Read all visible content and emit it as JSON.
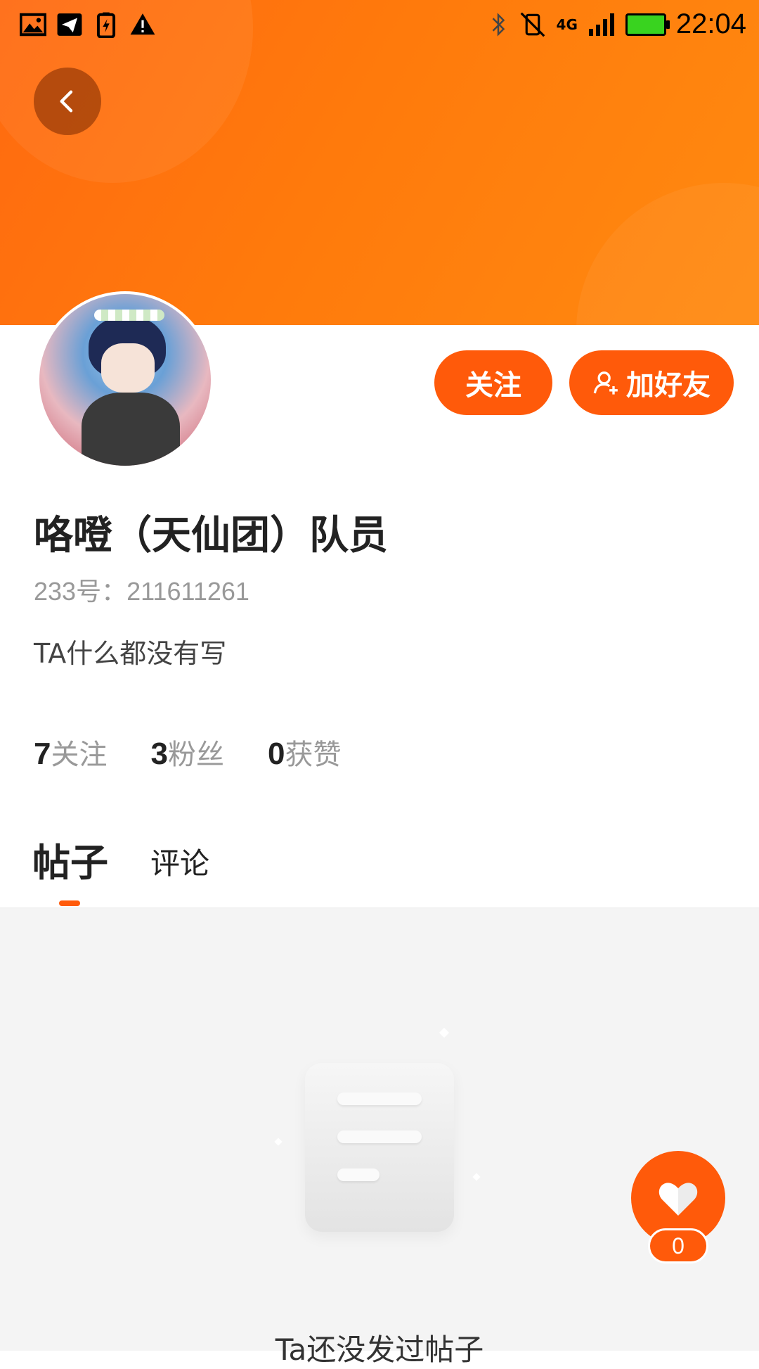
{
  "status_bar": {
    "time": "22:04",
    "network": "4G",
    "icons": [
      "image-icon",
      "send-icon",
      "battery-saver-icon",
      "warning-icon",
      "bluetooth-icon",
      "vibrate-off-icon",
      "signal-icon",
      "battery-icon"
    ]
  },
  "header": {
    "back_icon": "chevron-left-icon"
  },
  "actions": {
    "follow_label": "关注",
    "add_friend_label": "加好友",
    "add_friend_icon": "add-user-icon"
  },
  "profile": {
    "name": "咯噔（天仙团）队员",
    "uid": "233号：211611261",
    "bio": "TA什么都没有写"
  },
  "stats": [
    {
      "value": "7",
      "label": "关注"
    },
    {
      "value": "3",
      "label": "粉丝"
    },
    {
      "value": "0",
      "label": "获赞"
    }
  ],
  "tabs": {
    "posts": "帖子",
    "comments": "评论"
  },
  "empty_state": {
    "message": "Ta还没发过帖子"
  },
  "like": {
    "count": "0",
    "icon": "heart-icon"
  },
  "colors": {
    "accent": "#ff5a0a",
    "banner": "#ff7a0c",
    "content_bg": "#f4f4f4"
  }
}
